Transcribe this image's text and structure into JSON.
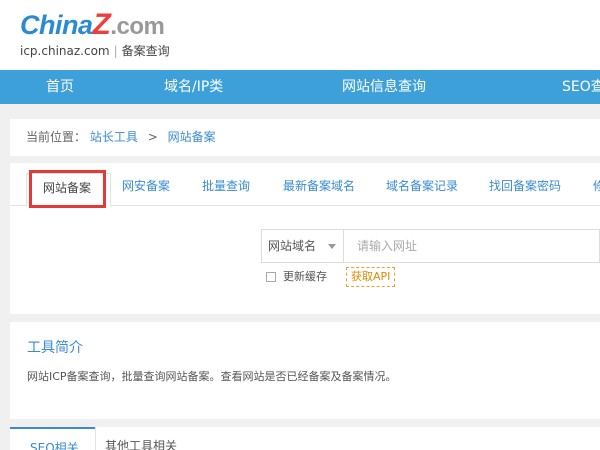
{
  "logo": {
    "brand_main": "China",
    "brand_z": "Z",
    "brand_com": ".com",
    "site_domain": "icp.chinaz.com",
    "separator": "|",
    "site_title": "备案查询"
  },
  "nav": {
    "items": [
      "首页",
      "域名/IP类",
      "网站信息查询",
      "SEO查"
    ]
  },
  "breadcrumb": {
    "label": "当前位置：",
    "items": [
      "站长工具",
      "网站备案"
    ],
    "separator": ">"
  },
  "tabs": {
    "items": [
      "网站备案",
      "网安备案",
      "批量查询",
      "最新备案域名",
      "域名备案记录",
      "找回备案密码",
      "修"
    ],
    "active_index": 0
  },
  "search": {
    "select_value": "网站域名",
    "input_placeholder": "请输入网址",
    "input_value": ""
  },
  "options": {
    "refresh_cache_label": "更新缓存",
    "refresh_cache_checked": false,
    "api_button_label": "获取API"
  },
  "intro": {
    "title": "工具简介",
    "description": "网站ICP备案查询，批量查询网站备案。查看网站是否已经备案及备案情况。"
  },
  "bottom_tabs": {
    "items": [
      "SEO相关",
      "其他工具相关"
    ],
    "active_index": 0
  },
  "colors": {
    "brand_blue": "#3da0d8",
    "link_blue": "#3a8bd1",
    "highlight_red": "#e53935",
    "api_orange": "#e08a00"
  }
}
